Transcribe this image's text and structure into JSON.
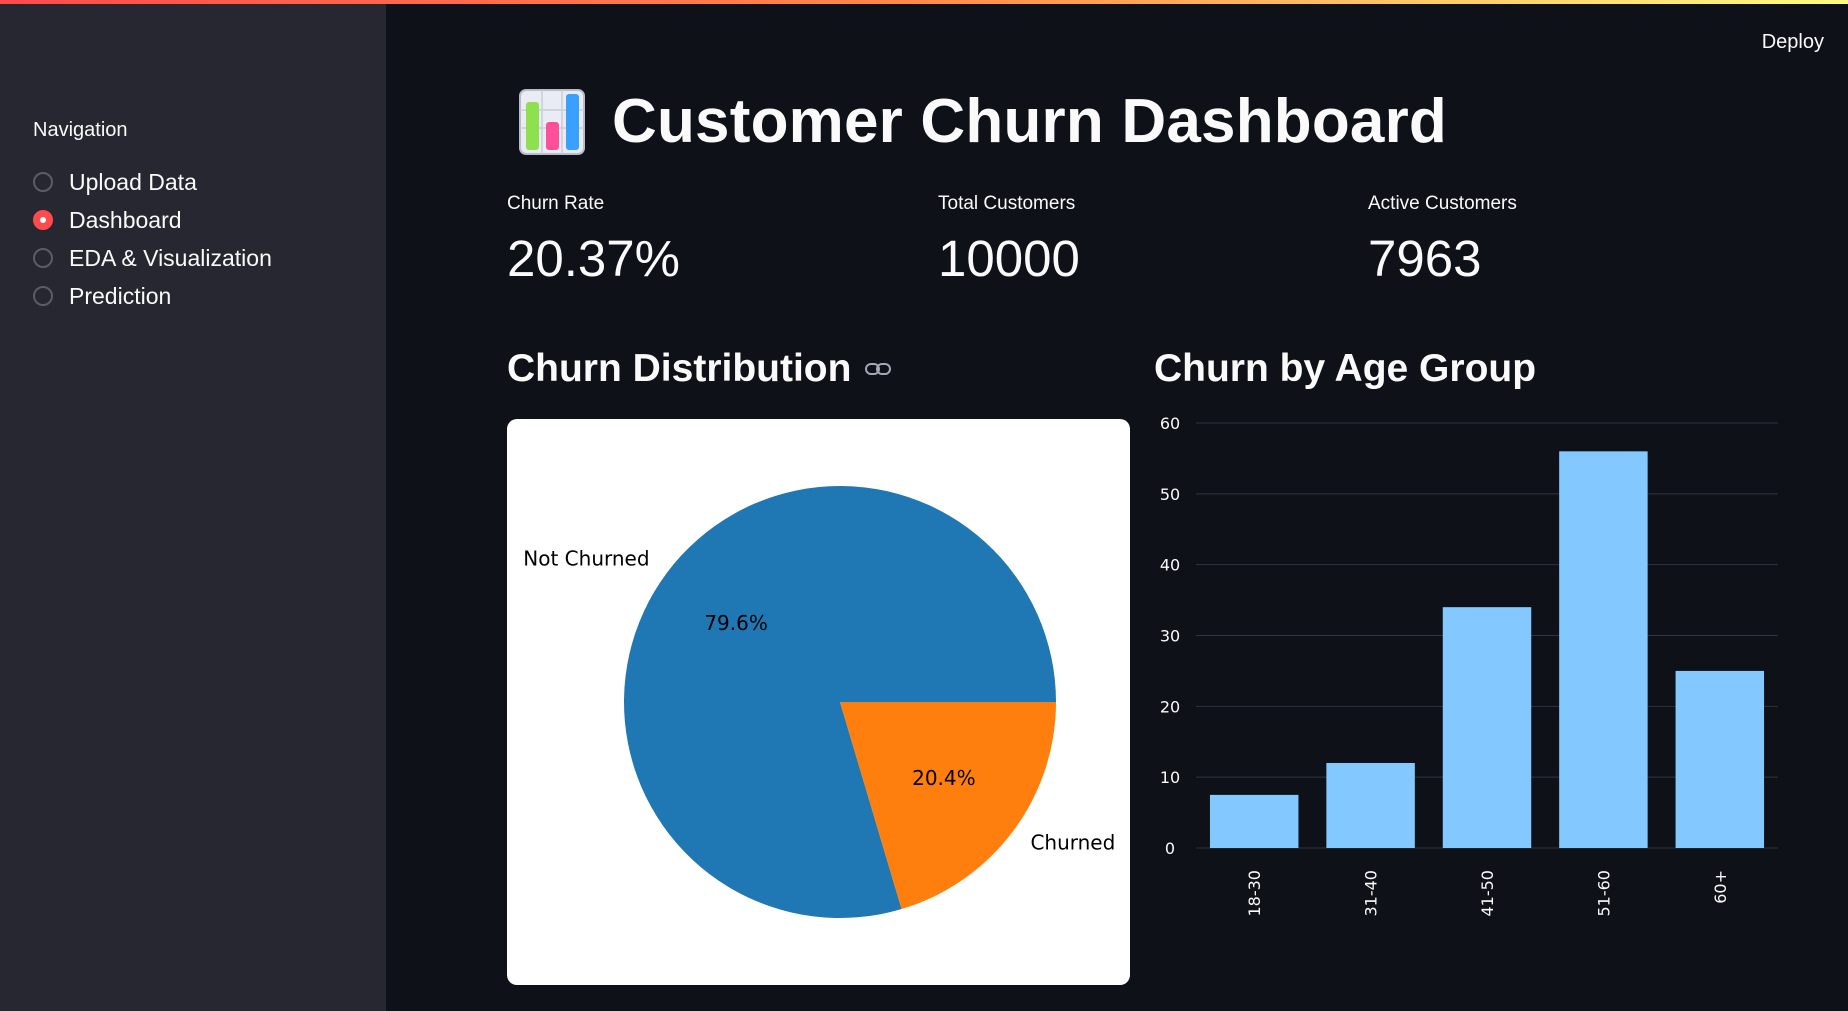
{
  "header": {
    "deploy_label": "Deploy"
  },
  "sidebar": {
    "title": "Navigation",
    "items": [
      {
        "label": "Upload Data",
        "selected": false
      },
      {
        "label": "Dashboard",
        "selected": true
      },
      {
        "label": "EDA & Visualization",
        "selected": false
      },
      {
        "label": "Prediction",
        "selected": false
      }
    ]
  },
  "main": {
    "title": "Customer Churn Dashboard",
    "title_icon": "bar-chart-icon",
    "metrics": [
      {
        "label": "Churn Rate",
        "value": "20.37%"
      },
      {
        "label": "Total Customers",
        "value": "10000"
      },
      {
        "label": "Active Customers",
        "value": "7963"
      }
    ],
    "sections": {
      "distribution_title": "Churn Distribution",
      "age_title": "Churn by Age Group"
    }
  },
  "colors": {
    "accent": "#ff4b4b",
    "pie_not_churned": "#1f77b4",
    "pie_churned": "#ff7f0e",
    "bar": "#83c9ff"
  },
  "chart_data": [
    {
      "type": "pie",
      "labels": [
        "Not Churned",
        "Churned"
      ],
      "values": [
        79.6,
        20.4
      ],
      "slice_labels": [
        "79.6%",
        "20.4%"
      ],
      "colors": [
        "#1f77b4",
        "#ff7f0e"
      ]
    },
    {
      "type": "bar",
      "categories": [
        "18-30",
        "31-40",
        "41-50",
        "51-60",
        "60+"
      ],
      "values": [
        7.5,
        12,
        34,
        56,
        25
      ],
      "ylim": [
        0,
        60
      ],
      "yticks": [
        0,
        10,
        20,
        30,
        40,
        50,
        60
      ],
      "grid": true,
      "color": "#83c9ff"
    }
  ]
}
